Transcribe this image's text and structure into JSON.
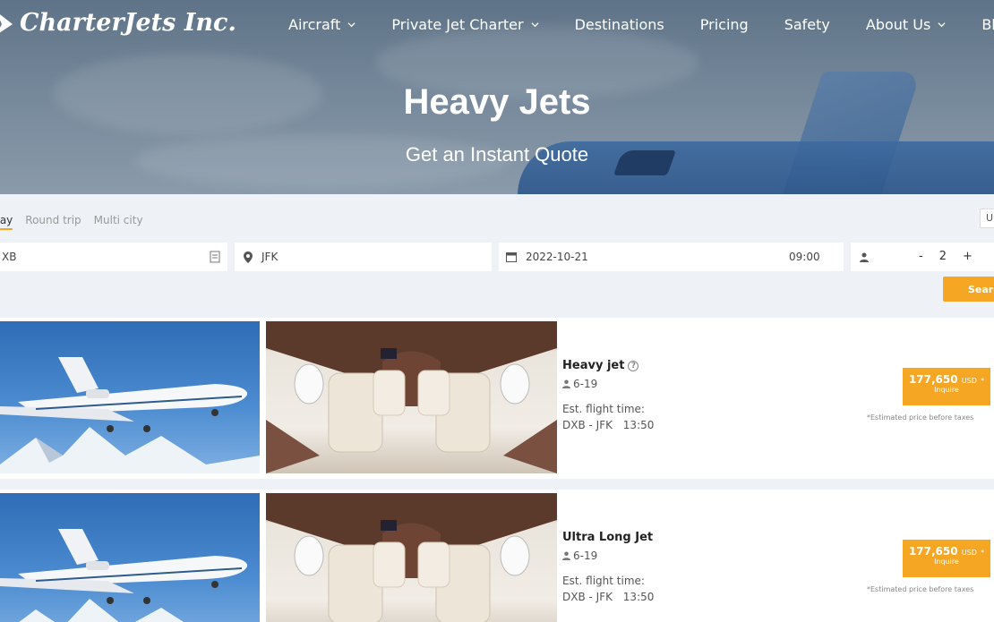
{
  "brand": {
    "name": "CharterJets Inc."
  },
  "nav": {
    "items": [
      {
        "label": "Aircraft",
        "dropdown": true
      },
      {
        "label": "Private Jet Charter",
        "dropdown": true
      },
      {
        "label": "Destinations",
        "dropdown": false
      },
      {
        "label": "Pricing",
        "dropdown": false
      },
      {
        "label": "Safety",
        "dropdown": false
      },
      {
        "label": "About Us",
        "dropdown": true
      },
      {
        "label": "Blog",
        "dropdown": false
      }
    ]
  },
  "hero": {
    "title": "Heavy Jets",
    "subtitle": "Get an Instant Quote"
  },
  "search": {
    "trip_types": [
      "way",
      "Round trip",
      "Multi city"
    ],
    "active_trip_type": "way",
    "unit_toggle": "U",
    "from": "XB",
    "to": "JFK",
    "date": "2022-10-21",
    "time": "09:00",
    "passengers": "2",
    "minus": "-",
    "plus": "+",
    "button_label": "Search"
  },
  "results": [
    {
      "title": "Heavy jet",
      "pax": "6-19",
      "flight_time_label": "Est. flight time:",
      "route": "DXB - JFK",
      "duration": "13:50",
      "price": "177,650",
      "currency": "USD",
      "price_suffix": "*",
      "cta": "Inquire",
      "note": "*Estimated price before taxes"
    },
    {
      "title": "Ultra Long Jet",
      "pax": "6-19",
      "flight_time_label": "Est. flight time:",
      "route": "DXB - JFK",
      "duration": "13:50",
      "price": "177,650",
      "currency": "USD",
      "price_suffix": "*",
      "cta": "Inquire",
      "note": "*Estimated price before taxes"
    }
  ],
  "colors": {
    "accent": "#f5a623",
    "hero_sky": "#748799",
    "page_bg": "#eef1f5"
  }
}
